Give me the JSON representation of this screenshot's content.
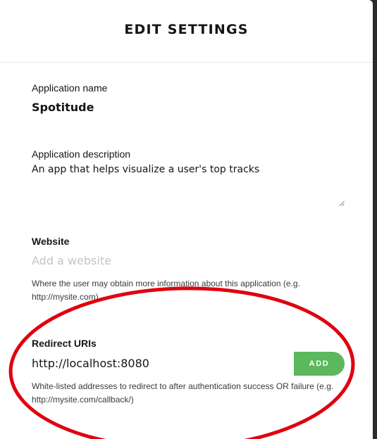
{
  "modal": {
    "title": "EDIT SETTINGS"
  },
  "form": {
    "app_name": {
      "label": "Application name",
      "value": "Spotitude"
    },
    "app_description": {
      "label": "Application description",
      "value": "An app that helps visualize a user's top tracks"
    },
    "website": {
      "label": "Website",
      "placeholder": "Add a website",
      "help": "Where the user may obtain more information about this application (e.g. http://mysite.com)"
    },
    "redirect_uris": {
      "label": "Redirect URIs",
      "value": "http://localhost:8080",
      "add_label": "ADD",
      "help": "White-listed addresses to redirect to after authentication success OR failure (e.g. http://mysite.com/callback/)"
    }
  },
  "colors": {
    "add_button": "#5cb85c",
    "annotation_ring": "#e0000f"
  }
}
